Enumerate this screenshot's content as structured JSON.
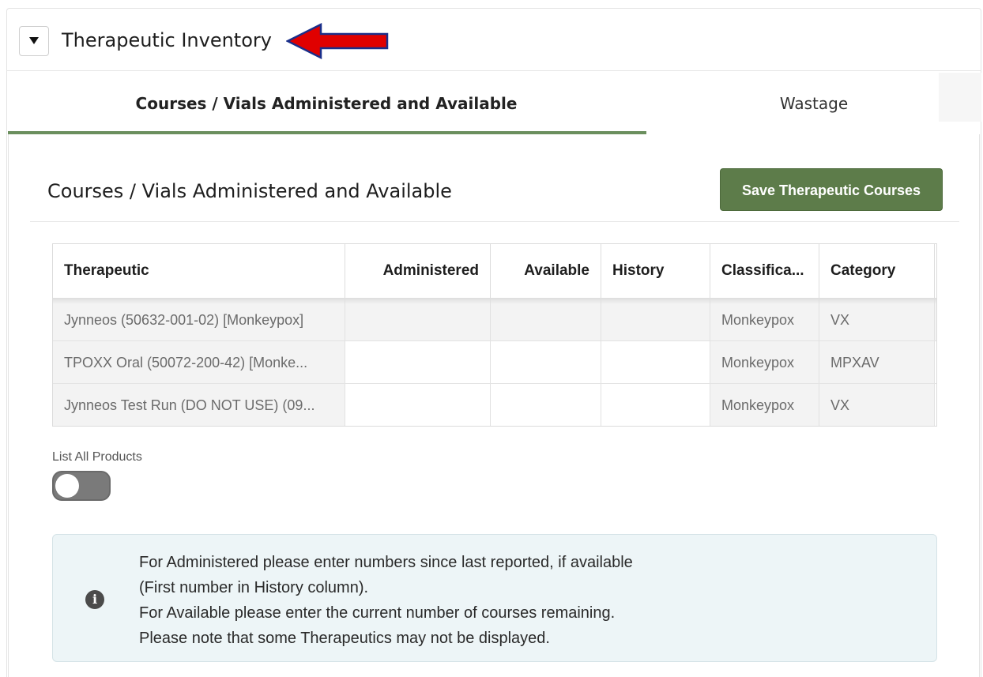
{
  "section": {
    "title": "Therapeutic Inventory"
  },
  "tabs": [
    {
      "label": "Courses / Vials Administered and Available",
      "active": true
    },
    {
      "label": "Wastage",
      "active": false
    }
  ],
  "card": {
    "title": "Courses / Vials Administered and Available",
    "save_label": "Save Therapeutic Courses"
  },
  "grid": {
    "columns": [
      "Therapeutic",
      "Administered",
      "Available",
      "History",
      "Classifica...",
      "Category"
    ],
    "rows": [
      {
        "therapeutic": "Jynneos (50632-001-02) [Monkeypox]",
        "administered": "",
        "available": "",
        "history": "",
        "classification": "Monkeypox",
        "category": "VX"
      },
      {
        "therapeutic": "TPOXX Oral (50072-200-42) [Monke...",
        "administered": "",
        "available": "",
        "history": "",
        "classification": "Monkeypox",
        "category": "MPXAV"
      },
      {
        "therapeutic": "Jynneos Test Run (DO NOT USE) (09...",
        "administered": "",
        "available": "",
        "history": "",
        "classification": "Monkeypox",
        "category": "VX"
      }
    ]
  },
  "toggle": {
    "label": "List All Products",
    "on": false
  },
  "info": {
    "icon": "info-icon",
    "lines": [
      "For Administered please enter numbers since last reported, if available",
      "(First number in History column).",
      "For Available please enter the current number of courses remaining.",
      "Please note that some Therapeutics may not be displayed."
    ]
  },
  "colors": {
    "accent": "#5d7c4a",
    "annotation_arrow": "#e00000",
    "info_bg": "#edf5f7"
  }
}
